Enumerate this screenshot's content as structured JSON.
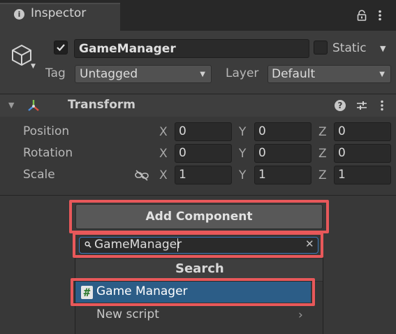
{
  "tab": {
    "title": "Inspector",
    "icon": "info-icon"
  },
  "header": {
    "active": true,
    "name": "GameManager",
    "static_label": "Static",
    "static": false,
    "tag_label": "Tag",
    "tag_value": "Untagged",
    "layer_label": "Layer",
    "layer_value": "Default"
  },
  "transform": {
    "title": "Transform",
    "rows": [
      {
        "label": "Position",
        "x": "0",
        "y": "0",
        "z": "0"
      },
      {
        "label": "Rotation",
        "x": "0",
        "y": "0",
        "z": "0"
      },
      {
        "label": "Scale",
        "x": "1",
        "y": "1",
        "z": "1"
      }
    ],
    "axes": {
      "x": "X",
      "y": "Y",
      "z": "Z"
    }
  },
  "add_component": {
    "button_label": "Add Component",
    "search_value": "GameManager",
    "search_title": "Search",
    "results": [
      {
        "label": "Game Manager",
        "icon": "script-hash-icon",
        "selected": true
      },
      {
        "label": "New script",
        "icon": "chevron-right-icon",
        "selected": false
      }
    ]
  },
  "colors": {
    "highlight": "#e8585a",
    "selection": "#2c5d87",
    "focus": "#3a79bb"
  }
}
